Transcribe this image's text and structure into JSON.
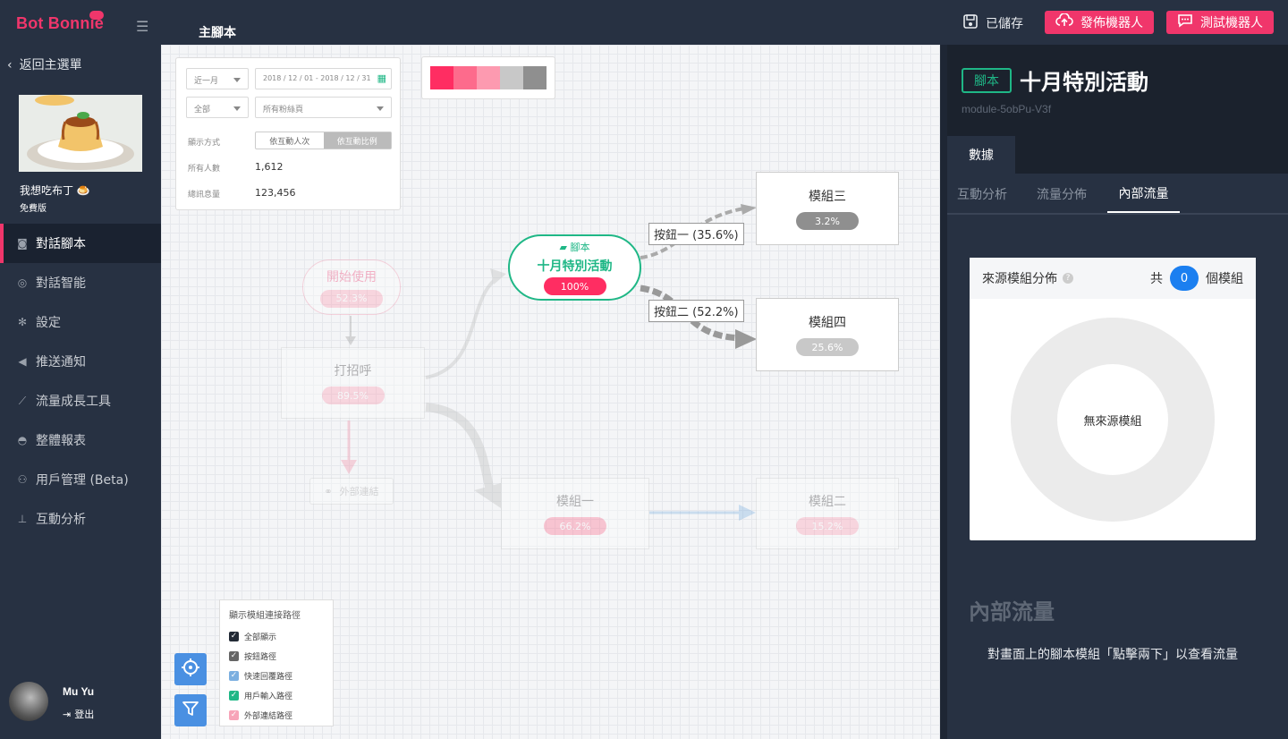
{
  "app": {
    "logo": "Bot Bonnie"
  },
  "sidebar": {
    "back_label": "返回主選單",
    "bot_name": "我想吃布丁 🍮",
    "plan": "免費版",
    "items": [
      {
        "label": "對話腳本",
        "icon": "robot-icon",
        "active": true
      },
      {
        "label": "對話智能",
        "icon": "brain-icon"
      },
      {
        "label": "設定",
        "icon": "gear-icon"
      },
      {
        "label": "推送通知",
        "icon": "megaphone-icon"
      },
      {
        "label": "流量成長工具",
        "icon": "chart-line-icon"
      },
      {
        "label": "整體報表",
        "icon": "dashboard-icon"
      },
      {
        "label": "用戶管理 (Beta)",
        "icon": "users-icon"
      },
      {
        "label": "互動分析",
        "icon": "sitemap-icon"
      }
    ],
    "user_name": "Mu Yu",
    "logout_label": "登出"
  },
  "header": {
    "title": "主腳本",
    "saved_label": "已儲存",
    "publish_label": "發佈機器人",
    "test_label": "測試機器人"
  },
  "filters": {
    "period": "近一月",
    "date_range": "2018 / 12 / 01 - 2018 / 12 / 31",
    "scope": "全部",
    "fanpage_placeholder": "所有粉絲頁",
    "display_mode_label": "顯示方式",
    "mode_count": "依互動人次",
    "mode_ratio": "依互動比例",
    "total_users_label": "所有人數",
    "total_users": "1,612",
    "total_messages_label": "總訊息量",
    "total_messages": "123,456"
  },
  "palette": [
    "#ff2d62",
    "#fd6b8c",
    "#fd9ab0",
    "#c8c8c8",
    "#8f8f8f"
  ],
  "nodes": {
    "start": {
      "title": "開始使用",
      "pct": "52.3%"
    },
    "greet": {
      "title": "打招呼",
      "pct": "89.5%"
    },
    "external": {
      "title": "外部連結"
    },
    "script": {
      "tag": "腳本",
      "title": "十月特別活動",
      "pct": "100%"
    },
    "mod3": {
      "title": "模組三",
      "pct": "3.2%"
    },
    "mod4": {
      "title": "模組四",
      "pct": "25.6%"
    },
    "mod1": {
      "title": "模組一",
      "pct": "66.2%"
    },
    "mod2": {
      "title": "模組二",
      "pct": "15.2%"
    }
  },
  "edges": {
    "btn1": "按鈕一 (35.6%)",
    "btn2": "按鈕二 (52.2%)"
  },
  "legend": {
    "title": "顯示模組連接路徑",
    "items": [
      {
        "label": "全部顯示",
        "color": "#222a35"
      },
      {
        "label": "按鈕路徑",
        "color": "#666666"
      },
      {
        "label": "快速回覆路徑",
        "color": "#7bafe0"
      },
      {
        "label": "用戶輸入路徑",
        "color": "#1fb786"
      },
      {
        "label": "外部連結路徑",
        "color": "#f7a4b8"
      }
    ]
  },
  "right_panel": {
    "tag": "腳本",
    "title": "十月特別活動",
    "module_id": "module-5obPu-V3f",
    "main_tab": "數據",
    "sub_tabs": [
      "互動分析",
      "流量分佈",
      "內部流量"
    ],
    "active_sub_tab": 2,
    "card_title": "來源模組分佈",
    "count_prefix": "共",
    "count": "0",
    "count_suffix": "個模組",
    "empty_label": "無來源模組",
    "flow_title": "內部流量",
    "flow_desc": "對畫面上的腳本模組「點擊兩下」以查看流量"
  },
  "colors": {
    "brand": "#f0366b",
    "accent_green": "#1fb786",
    "sidebar_bg": "#273142",
    "blue": "#4a90e2"
  }
}
